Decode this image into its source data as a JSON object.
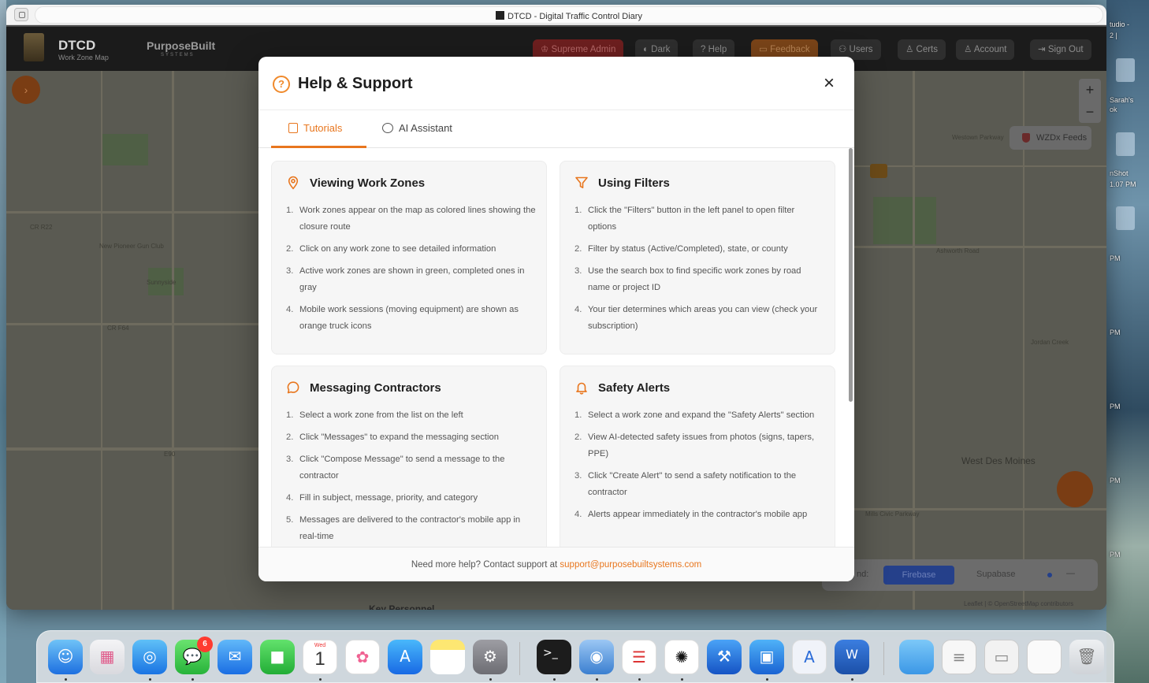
{
  "window": {
    "title": "DTCD - Digital Traffic Control Diary"
  },
  "app_header": {
    "brand": "DTCD",
    "brand_sub": "Work Zone Map",
    "partner": "PurposeBuilt",
    "partner_sub": "SYSTEMS",
    "buttons": {
      "supreme_admin": "Supreme Admin",
      "dark": "Dark",
      "help": "Help",
      "feedback": "Feedback",
      "users": "Users",
      "certs": "Certs",
      "account": "Account",
      "sign_out": "Sign Out"
    }
  },
  "map": {
    "wzdx_label": "WZDx Feeds",
    "zoom_in": "+",
    "zoom_out": "−",
    "city_label": "West Des Moines",
    "legend_label": "nd:",
    "legend_firebase": "Firebase",
    "legend_supabase": "Supabase",
    "legend_minimize": "—",
    "attribution": "Leaflet | © OpenStreetMap contributors",
    "key_personnel": "Key Personnel",
    "labels": [
      "CR R22",
      "CR F64",
      "Sunnyside",
      "New Pioneer Gun Club",
      "E90",
      "Ashworth Road",
      "Westown Parkway",
      "Mills Civic Parkway",
      "Jordan Creek"
    ]
  },
  "modal": {
    "title": "Help & Support",
    "close": "×",
    "tabs": [
      {
        "label": "Tutorials",
        "active": true
      },
      {
        "label": "AI Assistant",
        "active": false
      }
    ],
    "cards": [
      {
        "title": "Viewing Work Zones",
        "icon": "map-pin-icon",
        "steps": [
          "Work zones appear on the map as colored lines showing the closure route",
          "Click on any work zone to see detailed information",
          "Active work zones are shown in green, completed ones in gray",
          "Mobile work sessions (moving equipment) are shown as orange truck icons"
        ]
      },
      {
        "title": "Using Filters",
        "icon": "filter-icon",
        "steps": [
          "Click the \"Filters\" button in the left panel to open filter options",
          "Filter by status (Active/Completed), state, or county",
          "Use the search box to find specific work zones by road name or project ID",
          "Your tier determines which areas you can view (check your subscription)"
        ]
      },
      {
        "title": "Messaging Contractors",
        "icon": "message-icon",
        "steps": [
          "Select a work zone from the list on the left",
          "Click \"Messages\" to expand the messaging section",
          "Click \"Compose Message\" to send a message to the contractor",
          "Fill in subject, message, priority, and category",
          "Messages are delivered to the contractor's mobile app in real-time"
        ]
      },
      {
        "title": "Safety Alerts",
        "icon": "bell-icon",
        "steps": [
          "Select a work zone and expand the \"Safety Alerts\" section",
          "View AI-detected safety issues from photos (signs, tapers, PPE)",
          "Click \"Create Alert\" to send a safety notification to the contractor",
          "Alerts appear immediately in the contractor's mobile app"
        ]
      }
    ],
    "footer_text": "Need more help? Contact support at ",
    "footer_email": "support@purposebuiltsystems.com"
  },
  "desktop": {
    "labels": [
      "tudio -",
      "2 |",
      "Sarah's",
      "ok",
      "nShot",
      "1.07 PM",
      "PM",
      "PM",
      "PM",
      "PM",
      "PM"
    ]
  },
  "dock": {
    "calendar_day": "Wed",
    "calendar_date": "1",
    "messages_badge": "6",
    "apps": [
      "Finder",
      "Launchpad",
      "Safari",
      "Messages",
      "Mail",
      "FaceTime",
      "Calendar",
      "Photos",
      "App Store",
      "Notes",
      "System Settings",
      "Terminal",
      "Docker",
      "Page",
      "ChatGPT",
      "Xcode",
      "Windows App",
      "Instruments",
      "Word",
      "Folder",
      "Document",
      "Preview",
      "Screenshot",
      "Trash"
    ]
  },
  "colors": {
    "accent": "#e8761e",
    "modal_bg": "#ffffff",
    "card_bg": "#f6f6f6"
  }
}
